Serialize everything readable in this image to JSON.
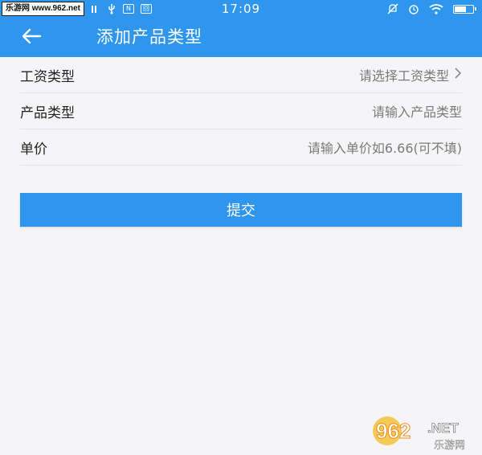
{
  "status_bar": {
    "watermark_text": "乐游网 www.962.net",
    "time": "17:09",
    "nfc_label": "N",
    "sim_label": "回"
  },
  "app_bar": {
    "title": "添加产品类型",
    "back_icon": "arrow-left-icon"
  },
  "form": {
    "rows": [
      {
        "label": "工资类型",
        "placeholder": "请选择工资类型",
        "has_chevron": true
      },
      {
        "label": "产品类型",
        "placeholder": "请输入产品类型"
      },
      {
        "label": "单价",
        "placeholder": "请输入单价如6.66(可不填)"
      }
    ],
    "submit_label": "提交"
  },
  "watermark_logo": {
    "brand": "962",
    "suffix": ".NET",
    "subtitle": "乐游网"
  },
  "colors": {
    "primary": "#2f96ee",
    "background": "#f5f5f7",
    "divider": "#e3e3e6",
    "label": "#222222",
    "placeholder": "#7a7a7a"
  }
}
